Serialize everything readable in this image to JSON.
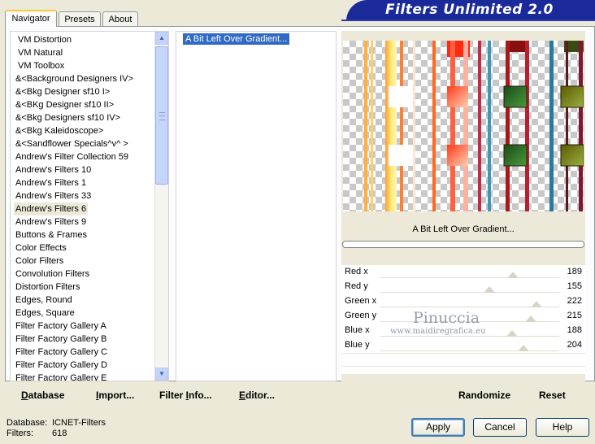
{
  "tabs": [
    "Navigator",
    "Presets",
    "About"
  ],
  "app_title": "Filters Unlimited 2.0",
  "categories": [
    "VM Distortion",
    "VM Natural",
    "VM Toolbox",
    "&<Background Designers IV>",
    "&<Bkg Designer sf10 I>",
    "&<BKg Designer sf10 II>",
    "&<Bkg Designers sf10 IV>",
    "&<Bkg Kaleidoscope>",
    "&<Sandflower Specials^v^ >",
    "Andrew's Filter Collection 59",
    "Andrew's Filters 10",
    "Andrew's Filters 1",
    "Andrew's Filters 33",
    "Andrew's Filters 6",
    "Andrew's Filters 9",
    "Buttons & Frames",
    "Color Effects",
    "Color Filters",
    "Convolution Filters",
    "Distortion Filters",
    "Edges, Round",
    "Edges, Square",
    "Filter Factory Gallery A",
    "Filter Factory Gallery B",
    "Filter Factory Gallery C",
    "Filter Factory Gallery D",
    "Filter Factory Gallery E"
  ],
  "selected_category": "Andrew's Filters 6",
  "filters": [
    "A Bit Left Over Gradient..."
  ],
  "preview_filter_name": "A Bit Left Over Gradient...",
  "parameters": [
    {
      "label": "Red x",
      "value": "189",
      "fraction": 0.741
    },
    {
      "label": "Red y",
      "value": "155",
      "fraction": 0.608
    },
    {
      "label": "Green x",
      "value": "222",
      "fraction": 0.871
    },
    {
      "label": "Green y",
      "value": "215",
      "fraction": 0.843
    },
    {
      "label": "Blue x",
      "value": "188",
      "fraction": 0.737
    },
    {
      "label": "Blue y",
      "value": "204",
      "fraction": 0.8
    }
  ],
  "watermark": {
    "name": "Pinuccia",
    "url": "www.maidiregrafica.eu"
  },
  "toolbar": {
    "database": {
      "u": "D",
      "rest": "atabase"
    },
    "import": {
      "u": "I",
      "rest": "mport..."
    },
    "filter_info": {
      "pre": "Filter ",
      "u": "I",
      "rest": "nfo..."
    },
    "editor": {
      "u": "E",
      "rest": "ditor..."
    },
    "randomize": "Randomize",
    "reset": "Reset"
  },
  "status": {
    "database_label": "Database:",
    "database_value": "ICNET-Filters",
    "filters_label": "Filters:",
    "filters_value": "618"
  },
  "buttons": {
    "apply": "Apply",
    "cancel": "Cancel",
    "help": "Help"
  },
  "colors": {
    "selection": "#316ac5",
    "banner": "#1a2a9a"
  }
}
